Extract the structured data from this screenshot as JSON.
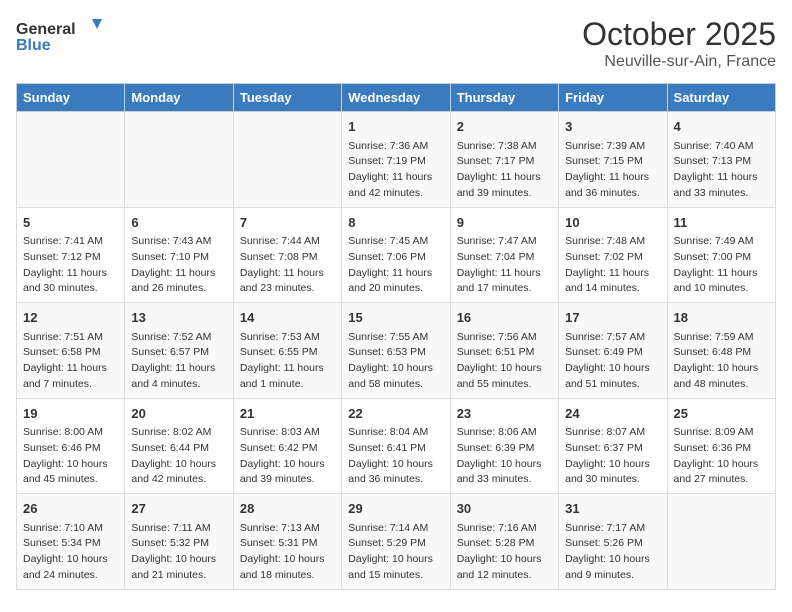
{
  "header": {
    "logo_general": "General",
    "logo_blue": "Blue",
    "month": "October 2025",
    "location": "Neuville-sur-Ain, France"
  },
  "weekdays": [
    "Sunday",
    "Monday",
    "Tuesday",
    "Wednesday",
    "Thursday",
    "Friday",
    "Saturday"
  ],
  "weeks": [
    [
      {
        "day": "",
        "info": ""
      },
      {
        "day": "",
        "info": ""
      },
      {
        "day": "",
        "info": ""
      },
      {
        "day": "1",
        "info": "Sunrise: 7:36 AM\nSunset: 7:19 PM\nDaylight: 11 hours and 42 minutes."
      },
      {
        "day": "2",
        "info": "Sunrise: 7:38 AM\nSunset: 7:17 PM\nDaylight: 11 hours and 39 minutes."
      },
      {
        "day": "3",
        "info": "Sunrise: 7:39 AM\nSunset: 7:15 PM\nDaylight: 11 hours and 36 minutes."
      },
      {
        "day": "4",
        "info": "Sunrise: 7:40 AM\nSunset: 7:13 PM\nDaylight: 11 hours and 33 minutes."
      }
    ],
    [
      {
        "day": "5",
        "info": "Sunrise: 7:41 AM\nSunset: 7:12 PM\nDaylight: 11 hours and 30 minutes."
      },
      {
        "day": "6",
        "info": "Sunrise: 7:43 AM\nSunset: 7:10 PM\nDaylight: 11 hours and 26 minutes."
      },
      {
        "day": "7",
        "info": "Sunrise: 7:44 AM\nSunset: 7:08 PM\nDaylight: 11 hours and 23 minutes."
      },
      {
        "day": "8",
        "info": "Sunrise: 7:45 AM\nSunset: 7:06 PM\nDaylight: 11 hours and 20 minutes."
      },
      {
        "day": "9",
        "info": "Sunrise: 7:47 AM\nSunset: 7:04 PM\nDaylight: 11 hours and 17 minutes."
      },
      {
        "day": "10",
        "info": "Sunrise: 7:48 AM\nSunset: 7:02 PM\nDaylight: 11 hours and 14 minutes."
      },
      {
        "day": "11",
        "info": "Sunrise: 7:49 AM\nSunset: 7:00 PM\nDaylight: 11 hours and 10 minutes."
      }
    ],
    [
      {
        "day": "12",
        "info": "Sunrise: 7:51 AM\nSunset: 6:58 PM\nDaylight: 11 hours and 7 minutes."
      },
      {
        "day": "13",
        "info": "Sunrise: 7:52 AM\nSunset: 6:57 PM\nDaylight: 11 hours and 4 minutes."
      },
      {
        "day": "14",
        "info": "Sunrise: 7:53 AM\nSunset: 6:55 PM\nDaylight: 11 hours and 1 minute."
      },
      {
        "day": "15",
        "info": "Sunrise: 7:55 AM\nSunset: 6:53 PM\nDaylight: 10 hours and 58 minutes."
      },
      {
        "day": "16",
        "info": "Sunrise: 7:56 AM\nSunset: 6:51 PM\nDaylight: 10 hours and 55 minutes."
      },
      {
        "day": "17",
        "info": "Sunrise: 7:57 AM\nSunset: 6:49 PM\nDaylight: 10 hours and 51 minutes."
      },
      {
        "day": "18",
        "info": "Sunrise: 7:59 AM\nSunset: 6:48 PM\nDaylight: 10 hours and 48 minutes."
      }
    ],
    [
      {
        "day": "19",
        "info": "Sunrise: 8:00 AM\nSunset: 6:46 PM\nDaylight: 10 hours and 45 minutes."
      },
      {
        "day": "20",
        "info": "Sunrise: 8:02 AM\nSunset: 6:44 PM\nDaylight: 10 hours and 42 minutes."
      },
      {
        "day": "21",
        "info": "Sunrise: 8:03 AM\nSunset: 6:42 PM\nDaylight: 10 hours and 39 minutes."
      },
      {
        "day": "22",
        "info": "Sunrise: 8:04 AM\nSunset: 6:41 PM\nDaylight: 10 hours and 36 minutes."
      },
      {
        "day": "23",
        "info": "Sunrise: 8:06 AM\nSunset: 6:39 PM\nDaylight: 10 hours and 33 minutes."
      },
      {
        "day": "24",
        "info": "Sunrise: 8:07 AM\nSunset: 6:37 PM\nDaylight: 10 hours and 30 minutes."
      },
      {
        "day": "25",
        "info": "Sunrise: 8:09 AM\nSunset: 6:36 PM\nDaylight: 10 hours and 27 minutes."
      }
    ],
    [
      {
        "day": "26",
        "info": "Sunrise: 7:10 AM\nSunset: 5:34 PM\nDaylight: 10 hours and 24 minutes."
      },
      {
        "day": "27",
        "info": "Sunrise: 7:11 AM\nSunset: 5:32 PM\nDaylight: 10 hours and 21 minutes."
      },
      {
        "day": "28",
        "info": "Sunrise: 7:13 AM\nSunset: 5:31 PM\nDaylight: 10 hours and 18 minutes."
      },
      {
        "day": "29",
        "info": "Sunrise: 7:14 AM\nSunset: 5:29 PM\nDaylight: 10 hours and 15 minutes."
      },
      {
        "day": "30",
        "info": "Sunrise: 7:16 AM\nSunset: 5:28 PM\nDaylight: 10 hours and 12 minutes."
      },
      {
        "day": "31",
        "info": "Sunrise: 7:17 AM\nSunset: 5:26 PM\nDaylight: 10 hours and 9 minutes."
      },
      {
        "day": "",
        "info": ""
      }
    ]
  ]
}
